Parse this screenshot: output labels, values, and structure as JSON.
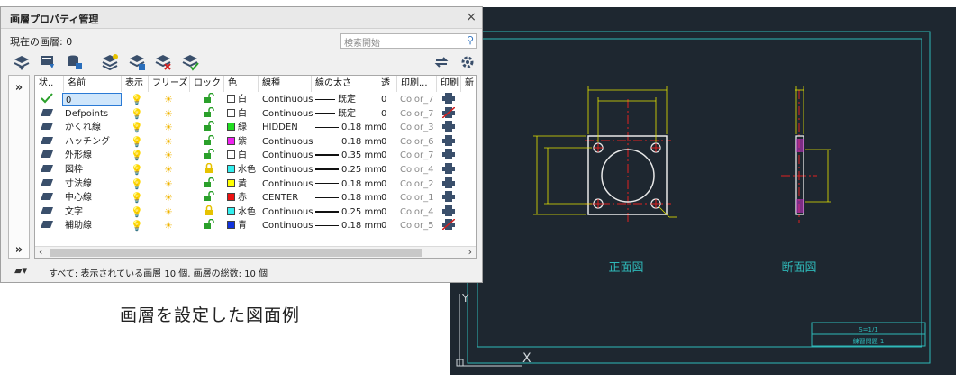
{
  "panel": {
    "title": "画層プロパティ管理",
    "close_glyph": "×",
    "current_layer": "現在の画層: 0",
    "search_placeholder": "検索開始",
    "footer_status": "すべて: 表示されている画層 10 個, 画層の総数: 10 個",
    "columns": [
      "状..",
      "名前",
      "表示",
      "フリーズ",
      "ロック",
      "色",
      "線種",
      "線の太さ",
      "透",
      "印刷...",
      "印刷",
      "新"
    ],
    "layers": [
      {
        "name": "0",
        "color_name": "白",
        "color": "#ffffff",
        "linetype": "Continuous",
        "lineweight": "既定",
        "transparency": "0",
        "plot_style": "Color_7",
        "current": true,
        "locked": false,
        "printable": true
      },
      {
        "name": "Defpoints",
        "color_name": "白",
        "color": "#ffffff",
        "linetype": "Continuous",
        "lineweight": "既定",
        "transparency": "0",
        "plot_style": "Color_7",
        "current": false,
        "locked": false,
        "printable": false
      },
      {
        "name": "かくれ線",
        "color_name": "緑",
        "color": "#22dd22",
        "linetype": "HIDDEN",
        "lineweight": "0.18 mm",
        "transparency": "0",
        "plot_style": "Color_3",
        "current": false,
        "locked": false,
        "printable": true
      },
      {
        "name": "ハッチング",
        "color_name": "紫",
        "color": "#ee22ee",
        "linetype": "Continuous",
        "lineweight": "0.18 mm",
        "transparency": "0",
        "plot_style": "Color_6",
        "current": false,
        "locked": false,
        "printable": true
      },
      {
        "name": "外形線",
        "color_name": "白",
        "color": "#ffffff",
        "linetype": "Continuous",
        "lineweight": "0.35 mm",
        "transparency": "0",
        "plot_style": "Color_7",
        "current": false,
        "locked": false,
        "printable": true
      },
      {
        "name": "図枠",
        "color_name": "水色",
        "color": "#33eeee",
        "linetype": "Continuous",
        "lineweight": "0.25 mm",
        "transparency": "0",
        "plot_style": "Color_4",
        "current": false,
        "locked": true,
        "printable": true
      },
      {
        "name": "寸法線",
        "color_name": "黄",
        "color": "#ffff00",
        "linetype": "Continuous",
        "lineweight": "0.18 mm",
        "transparency": "0",
        "plot_style": "Color_2",
        "current": false,
        "locked": false,
        "printable": true
      },
      {
        "name": "中心線",
        "color_name": "赤",
        "color": "#ee1111",
        "linetype": "CENTER",
        "lineweight": "0.18 mm",
        "transparency": "0",
        "plot_style": "Color_1",
        "current": false,
        "locked": false,
        "printable": true
      },
      {
        "name": "文字",
        "color_name": "水色",
        "color": "#33eeee",
        "linetype": "Continuous",
        "lineweight": "0.25 mm",
        "transparency": "0",
        "plot_style": "Color_4",
        "current": false,
        "locked": true,
        "printable": true
      },
      {
        "name": "補助線",
        "color_name": "青",
        "color": "#1133dd",
        "linetype": "Continuous",
        "lineweight": "0.18 mm",
        "transparency": "0",
        "plot_style": "Color_5",
        "current": false,
        "locked": false,
        "printable": false
      }
    ]
  },
  "caption": "画層を設定した図面例",
  "drawing": {
    "front_view_label": "正面図",
    "section_view_label": "断面図",
    "scale_text": "S=1/1",
    "title_block_name": "練習問題 1",
    "ucs_y": "Y",
    "ucs_x": "X"
  },
  "colors": {
    "canvas_bg": "#1e2730",
    "frame": "#2fb8b8",
    "outline": "#e8e8e8",
    "center": "#e02020",
    "dimension": "#e6e600",
    "hatch": "#cc33cc",
    "hidden": "#22cc22",
    "selection": "#cfe6fb"
  }
}
